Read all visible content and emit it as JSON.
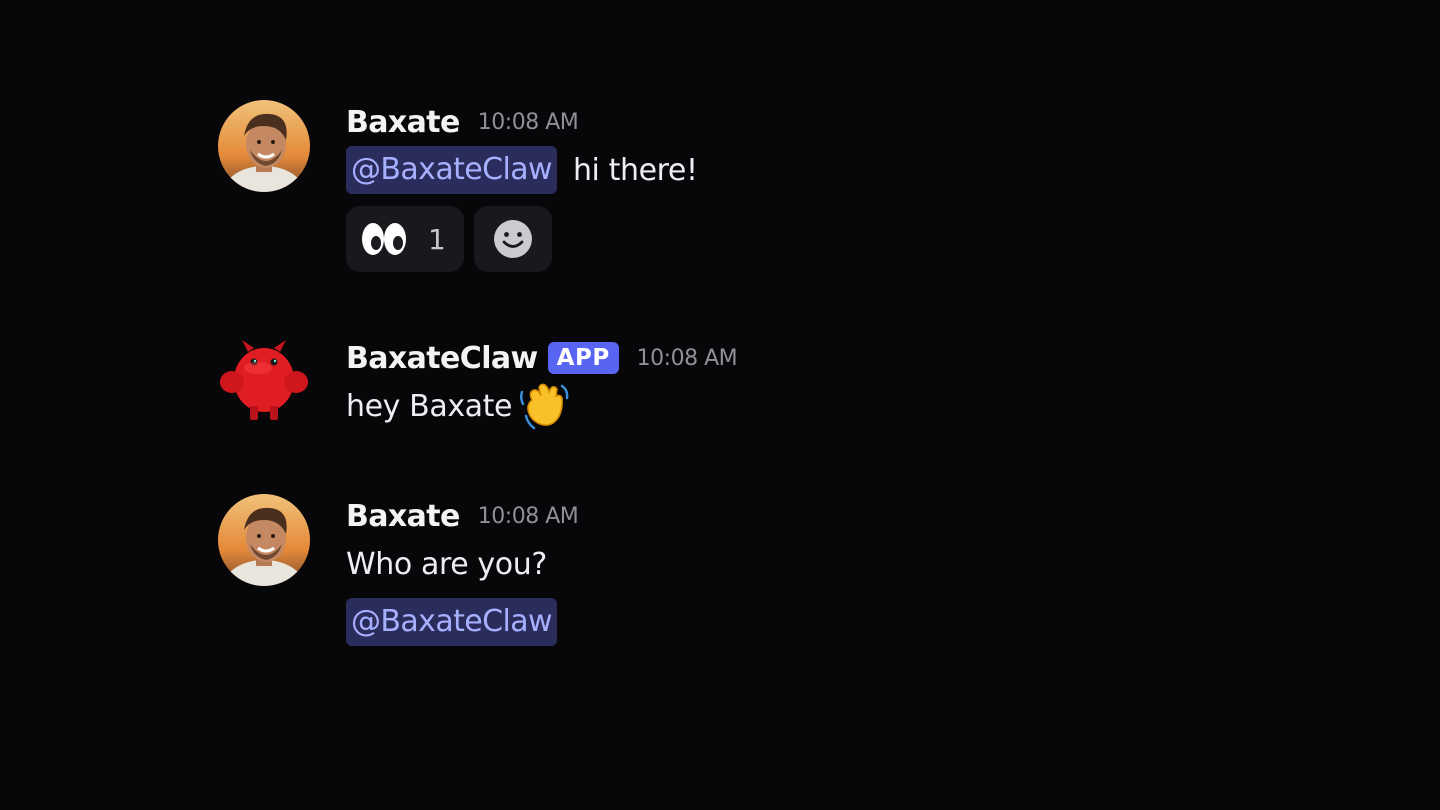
{
  "messages": [
    {
      "author": "Baxate",
      "timestamp": "10:08 AM",
      "mention": "@BaxateClaw",
      "text": "hi there!",
      "reactions": [
        {
          "emoji": "eyes-icon",
          "count": "1"
        },
        {
          "emoji": "add-reaction-icon"
        }
      ]
    },
    {
      "author": "BaxateClaw",
      "badge": "APP",
      "timestamp": "10:08 AM",
      "text": "hey Baxate",
      "emoji": "waving-hand-icon"
    },
    {
      "author": "Baxate",
      "timestamp": "10:08 AM",
      "text": "Who are you?",
      "mention": "@BaxateClaw"
    }
  ],
  "colors": {
    "background": "#070709",
    "mention_bg": "#2a2d5c",
    "mention_text": "#a6b0ff",
    "app_badge": "#5865f2",
    "timestamp": "#8e9097",
    "reaction_bg": "#18191c"
  }
}
